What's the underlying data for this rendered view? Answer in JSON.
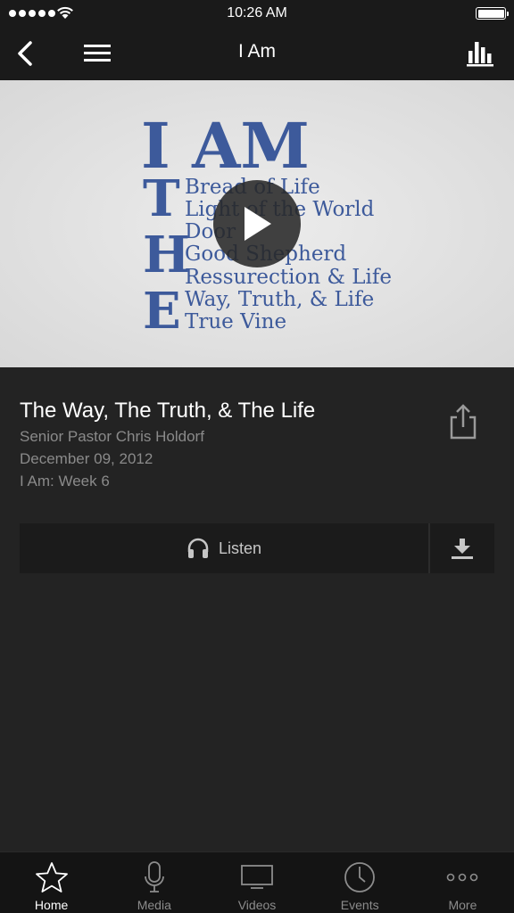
{
  "status_bar": {
    "time": "10:26 AM"
  },
  "nav": {
    "title": "I Am",
    "icons": [
      "back-arrow-icon",
      "hamburger-menu-icon",
      "bar-chart-icon"
    ]
  },
  "artwork": {
    "heading": "I AM",
    "letters": [
      "T",
      "H",
      "E"
    ],
    "lines": [
      "Bread of Life",
      "Light of the World",
      "Door",
      "Good Shepherd",
      "Ressurection & Life",
      "Way, Truth, & Life",
      "True Vine"
    ],
    "text_color": "#3d5a9b",
    "play_icon": "play-icon"
  },
  "sermon": {
    "title": "The Way, The Truth, & The Life",
    "speaker": "Senior Pastor Chris Holdorf",
    "date": "December 09, 2012",
    "series": "I Am: Week 6",
    "share_icon": "share-icon"
  },
  "actions": {
    "listen_label": "Listen",
    "listen_icon": "headphones-icon",
    "download_icon": "download-icon"
  },
  "tabs": [
    {
      "label": "Home",
      "icon": "star-icon",
      "active": true
    },
    {
      "label": "Media",
      "icon": "microphone-icon",
      "active": false
    },
    {
      "label": "Videos",
      "icon": "monitor-icon",
      "active": false
    },
    {
      "label": "Events",
      "icon": "clock-icon",
      "active": false
    },
    {
      "label": "More",
      "icon": "more-dots-icon",
      "active": false
    }
  ]
}
